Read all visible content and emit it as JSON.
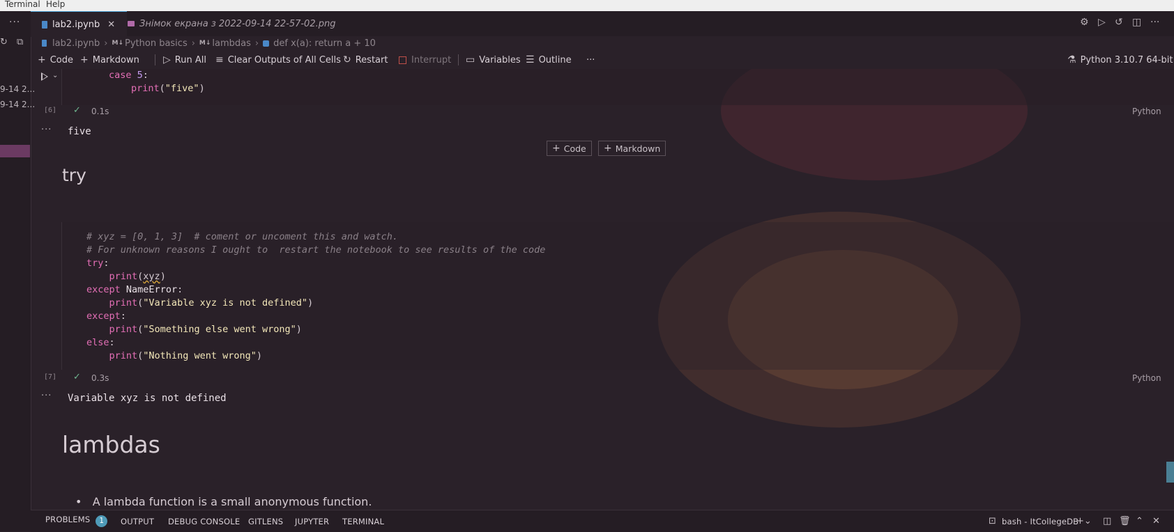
{
  "menubar": {
    "items": [
      "Terminal",
      "Help"
    ]
  },
  "sidebar": {
    "more": "···",
    "entries": [
      "9-14 2...",
      "9-14 2..."
    ]
  },
  "tabs": [
    {
      "label": "lab2.ipynb",
      "active": true,
      "icon": "notebook-icon",
      "icon_color": "#4a88c7"
    },
    {
      "label": "Знімок екрана з 2022-09-14 22-57-02.png",
      "active": false,
      "icon": "image-icon",
      "icon_color": "#b06aa8"
    }
  ],
  "titlebar_actions": [
    "gear-icon",
    "run-icon",
    "history-icon",
    "split-editor-icon",
    "more-icon"
  ],
  "breadcrumb": {
    "file": "lab2.ipynb",
    "md_tag": "M↓",
    "section": "Python basics",
    "subsection": "lambdas",
    "symbol": "def x(a): return a + 10"
  },
  "toolbar": {
    "add_code": "Code",
    "add_markdown": "Markdown",
    "run_all": "Run All",
    "clear_outputs": "Clear Outputs of All Cells",
    "restart": "Restart",
    "interrupt": "Interrupt",
    "variables": "Variables",
    "outline": "Outline",
    "more": "···",
    "kernel": "Python 3.10.7 64-bit"
  },
  "cells": {
    "cell6": {
      "lines": {
        "l1_kw": "case ",
        "l1_num": "5",
        "l1_end": ":",
        "l2_fn": "print",
        "l2_open": "(",
        "l2_str": "\"five\"",
        "l2_close": ")"
      },
      "exec_count": "[6]",
      "duration": "0.1s",
      "language": "Python",
      "output": "five"
    },
    "insert_buttons": {
      "code": "Code",
      "markdown": "Markdown"
    },
    "heading_try": "try",
    "cell7": {
      "comment1": "# xyz = [0, 1, 3]  # coment or uncoment this and watch.",
      "comment2": "# For unknown reasons I ought to  restart the notebook to see results of the code",
      "try_kw": "try",
      "colon": ":",
      "print": "print",
      "xyz": "xyz",
      "except_kw": "except",
      "nameerror": "NameError",
      "str1": "\"Variable xyz is not defined\"",
      "str2": "\"Something else went wrong\"",
      "else_kw": "else",
      "str3": "\"Nothing went wrong\"",
      "exec_count": "[7]",
      "duration": "0.3s",
      "language": "Python",
      "output": "Variable xyz is not defined"
    },
    "heading_lambdas": "lambdas",
    "bullet1": "A lambda function is a small anonymous function."
  },
  "panel": {
    "tabs": [
      "PROBLEMS",
      "OUTPUT",
      "DEBUG CONSOLE",
      "GITLENS",
      "JUPYTER",
      "TERMINAL"
    ],
    "problems_count": "1",
    "terminal_name": "bash - ItCollegeDB"
  },
  "colors": {
    "accent": "#4da3d8",
    "badge": "#4f9bb8",
    "keyword": "#e46fb6",
    "string": "#f2e6b8",
    "number": "#c59cf0"
  }
}
